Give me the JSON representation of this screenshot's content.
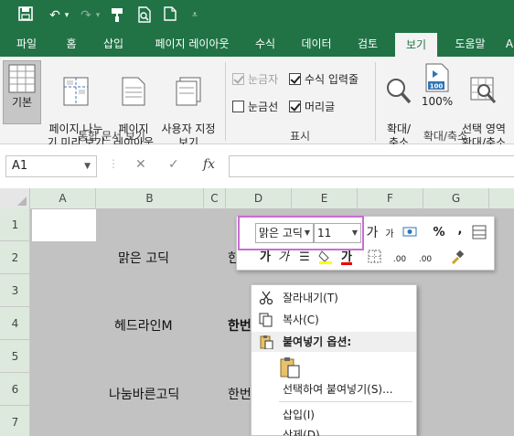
{
  "ribbon_tabs": [
    {
      "label": "파일"
    },
    {
      "label": "홈"
    },
    {
      "label": "삽입"
    },
    {
      "label": "페이지 레이아웃"
    },
    {
      "label": "수식"
    },
    {
      "label": "데이터"
    },
    {
      "label": "검토"
    },
    {
      "label": "보기"
    },
    {
      "label": "도움말"
    },
    {
      "label": "A"
    }
  ],
  "active_tab": "보기",
  "workbook_views": {
    "normal_label": "기본",
    "page_break_label": "페이지 나누\n기 미리 보기",
    "page_layout_label": "페이지\n레이아웃",
    "custom_views_label": "사용자 지정\n보기",
    "group_label": "통합 문서 보기"
  },
  "show": {
    "ruler_label": "눈금자",
    "formula_bar_label": "수식 입력줄",
    "gridlines_label": "눈금선",
    "headings_label": "머리글",
    "group_label": "표시",
    "ruler_checked": true,
    "formula_bar_checked": true,
    "gridlines_checked": false,
    "headings_checked": true
  },
  "zoom": {
    "zoom_label": "확대/\n축소",
    "hundred_label": "100%",
    "selection_label": "선택 영역\n확대/축소",
    "group_label": "확대/축소",
    "hundred_icon_text": "100"
  },
  "formula_bar": {
    "name_box": "A1",
    "fx": "fx",
    "cancel": "✕",
    "enter": "✓"
  },
  "columns": [
    "A",
    "B",
    "C",
    "D",
    "E",
    "F",
    "G"
  ],
  "rows": [
    "1",
    "2",
    "3",
    "4",
    "5",
    "6",
    "7"
  ],
  "cells": {
    "B2": "맑은 고딕",
    "D2": "한번",
    "B4": "헤드라인M",
    "D4": "한번",
    "B6": "나눔바른고딕",
    "D6": "한번"
  },
  "mini_toolbar": {
    "font_name": "맑은 고딕",
    "font_size": "11",
    "grow_font": "가",
    "shrink_font": "가",
    "percent": "%",
    "comma": ",",
    "bold": "가",
    "italic": "가",
    "font_color_letter": "가",
    "dec_increase": ".00",
    "dec_decrease": ".00"
  },
  "context_menu": [
    {
      "label": "잘라내기(T)",
      "icon": "scissors-icon"
    },
    {
      "label": "복사(C)",
      "icon": "copy-icon"
    },
    {
      "label": "붙여넣기 옵션:",
      "icon": "paste-icon"
    },
    {
      "label": "",
      "icon": "paste-option-icon"
    },
    {
      "label": "선택하여 붙여넣기(S)...",
      "icon": ""
    },
    {
      "label": "삽입(I)",
      "icon": ""
    },
    {
      "label": "삭제(D)",
      "icon": ""
    }
  ],
  "colors": {
    "brand": "#217346",
    "highlight": "#c86dd3"
  }
}
